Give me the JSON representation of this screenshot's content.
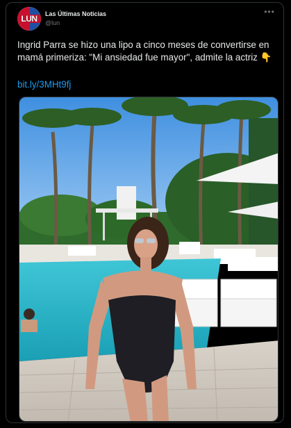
{
  "account": {
    "name": "Las Últimas Noticias",
    "handle": "@lun",
    "avatar_logo_text": "LUN"
  },
  "tweet": {
    "text": "Ingrid Parra se hizo una lipo a cinco meses de convertirse en mamá primeriza: \"Mi ansiedad fue mayor\", admite la actriz 👇",
    "link": "bit.ly/3MHt9fj"
  },
  "icons": {
    "more": "more-options-icon"
  },
  "colors": {
    "background": "#000000",
    "text": "#e7e9ea",
    "muted": "#71767b",
    "link": "#1d9bf0",
    "border": "#2f3336",
    "brand_red": "#c8102e",
    "brand_blue": "#1f4fa3"
  }
}
